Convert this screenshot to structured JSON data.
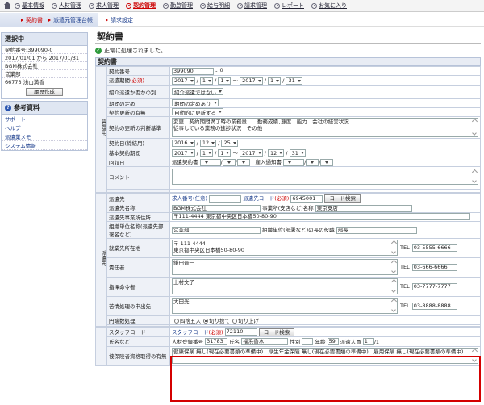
{
  "topnav": [
    "基本情報",
    "人材管理",
    "求人管理",
    "契約管理",
    "勤怠管理",
    "給与明細",
    "請求管理",
    "レポート",
    "お気に入り"
  ],
  "topnav_active": 3,
  "subnav": [
    "契約書",
    "派遣元管理台帳",
    "請求設定"
  ],
  "sidebar": {
    "selected_title": "選択中",
    "lines": [
      "契約番号:399090-0",
      "2017/01/01 から 2017/01/31",
      "BGM株式会社",
      "営業部",
      "66773 浅山満香"
    ],
    "change_button": "履歴作成",
    "ref_title": "参考資料",
    "ref_links": [
      "サポート",
      "ヘルプ",
      "派遣業メモ",
      "システム情報"
    ]
  },
  "page_title": "契約書",
  "ok_message": "正常に処理されました。",
  "section_title": "契約書",
  "mgmt_group": "管理用",
  "rows": {
    "contract_no_label": "契約番号",
    "contract_no": "399090",
    "contract_no_sub": "0",
    "period_label": "派遣期間",
    "period_req": "(必須)",
    "period": {
      "y1": "2017",
      "m1": "1",
      "d1": "1",
      "y2": "2017",
      "m2": "1",
      "d2": "31"
    },
    "intro_label": "紹介派遣か否かの別",
    "intro_value": "紹介派遣ではない",
    "term_label": "期間の定め",
    "term_value": "期間の定めあり",
    "renew_label": "契約更新の有無",
    "renew_value": "自動的に更新する",
    "renew_judge_label": "契約の更新の判断基準",
    "renew_judge_value": "変更　契約期間満了時の業務量　　勤務成績､態度　能力　会社の経営状況\n従事している業務の進捗状況　その他",
    "sign_date_label": "契約日(締結用)",
    "sign_date": {
      "y": "2016",
      "m": "12",
      "d": "25"
    },
    "base_period_label": "基本契約期間",
    "base_period": {
      "y1": "2017",
      "m1": "1",
      "d1": "1",
      "y2": "2017",
      "m2": "12",
      "d2": "31"
    },
    "collect_label": "回収日",
    "collect_a": "派遣契約書",
    "collect_b": "雇入通知書",
    "comment_label": "コメント"
  },
  "dispatch_group": "派遣先",
  "dispatch": {
    "dest_label": "派遣先",
    "job_no_link": "求人番号(任意)",
    "dest_code_link": "派遣先コード",
    "dest_code_req": "(必須)",
    "dest_code": "6945001",
    "code_search": "コード検索",
    "dest_name_label": "派遣先名称",
    "dest_name": "BGM株式会社",
    "office_label": "事業所(支店など)名称",
    "office_name": "東京支店",
    "address_label": "派遣先事業所住所",
    "address": "〒111-4444 東京都中央区日本橋50-80-90",
    "org_label": "組織単位名称(派遣先部署名など)",
    "org_name": "営業部",
    "org_head_label": "組織単位(部署など)の長の役職",
    "org_head": "部長",
    "place_label": "就業先所在地",
    "place": "〒 111-4444\n東京都中央区日本橋50-80-90",
    "tel_label": "TEL",
    "place_tel": "03-5555-6666",
    "resp_label": "責任者",
    "resp": "鎌田晋一",
    "resp_tel": "03-666-6666",
    "cmd_label": "指揮命令者",
    "cmd": "上村文子",
    "cmd_tel": "03-7777-7777",
    "complaint_label": "苦情処理の申出先",
    "complaint": "大田光",
    "complaint_tel": "03-8888-8888",
    "round_label": "円端数処理",
    "round_options": [
      "四捨五入",
      "切り捨て",
      "切り上げ"
    ],
    "round_selected": 1
  },
  "staff": {
    "code_label": "スタッフコード",
    "code_link": "スタッフコード",
    "code_req": "(必須)",
    "code": "72110",
    "code_search": "コード検索",
    "name_label": "氏名など",
    "reg_no_label": "人材登録番号",
    "reg_no": "31783",
    "name_label2": "氏名",
    "name": "福浜香水",
    "gender_label": "性別",
    "gender": "",
    "age_label": "年齢",
    "age": "59",
    "count_label": "派遣人員",
    "count": "1",
    "count_total": "/1",
    "ins_label": "被保険者資格取得の有無",
    "ins_value": "健康保険 無し(現在必要書類の準備中)　厚生年金保険 無し(現在必要書類の準備中)　雇用保険 無し(現在必要書類の準備中)"
  }
}
